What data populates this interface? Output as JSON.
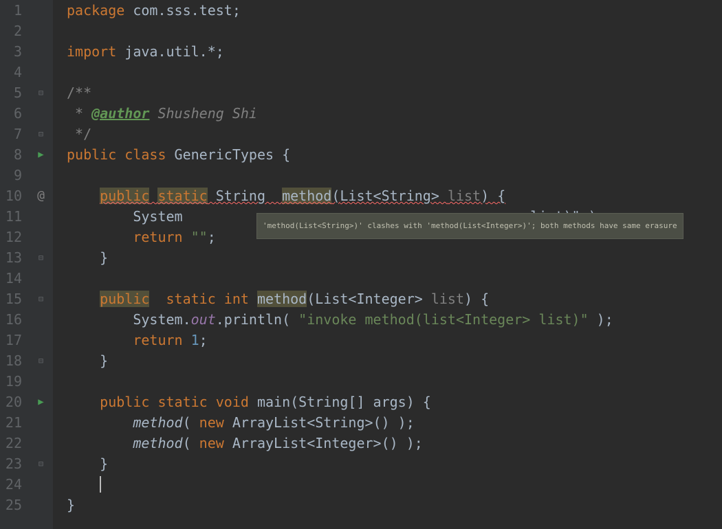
{
  "gutter": {
    "lines": [
      "1",
      "2",
      "3",
      "4",
      "5",
      "6",
      "7",
      "8",
      "9",
      "10",
      "11",
      "12",
      "13",
      "14",
      "15",
      "16",
      "17",
      "18",
      "19",
      "20",
      "21",
      "22",
      "23",
      "24",
      "25"
    ]
  },
  "icons": {
    "play": "▶",
    "fold_open": "⊟",
    "fold_close": "⊟",
    "at": "@",
    "collapse": "⊟"
  },
  "tooltip": "'method(List<String>)' clashes with 'method(List<Integer>)'; both methods have same erasure",
  "code": {
    "l1_package": "package ",
    "l1_pkg": "com.sss.test;",
    "l3_import": "import ",
    "l3_pkg": "java.util.*;",
    "l5_doc": "/**",
    "l6_star": " * ",
    "l6_tag": "@author",
    "l6_author": " Shusheng Shi",
    "l7_doc": " */",
    "l8_public": "public class ",
    "l8_class": "GenericTypes ",
    "l8_brace": "{",
    "l10_pub": "public",
    "l10_sp1": " ",
    "l10_static": "static",
    "l10_sp2": " ",
    "l10_type": "String  ",
    "l10_method": "method",
    "l10_paren1": "(",
    "l10_param": "List<String> ",
    "l10_list": "list",
    "l10_paren2": ") {",
    "l11_sys": "System",
    "l12_ret": "return ",
    "l12_str": "\"\"",
    "l12_semi": ";",
    "l13_brace": "}",
    "l15_pub": "public",
    "l15_sp1": "  ",
    "l15_static": "static int ",
    "l15_method": "method",
    "l15_paren1": "(List<Integer> ",
    "l15_list": "list",
    "l15_paren2": ") {",
    "l16_prefix": "System.",
    "l16_out": "out",
    "l16_print": ".println( ",
    "l16_str": "\"invoke method(list<Integer> list)\"",
    "l16_end": " );",
    "l17_ret": "return ",
    "l17_num": "1",
    "l17_semi": ";",
    "l18_brace": "}",
    "l20_decl": "public static void ",
    "l20_main": "main",
    "l20_params": "(String[] args) {",
    "l21_method": "method",
    "l21_call": "( ",
    "l21_new": "new ",
    "l21_type": "ArrayList<String>() );",
    "l22_method": "method",
    "l22_call": "( ",
    "l22_new": "new ",
    "l22_type": "ArrayList<Integer>() );",
    "l23_brace": "}",
    "l25_brace": "}",
    "l11_suffix": " list)\" );"
  }
}
